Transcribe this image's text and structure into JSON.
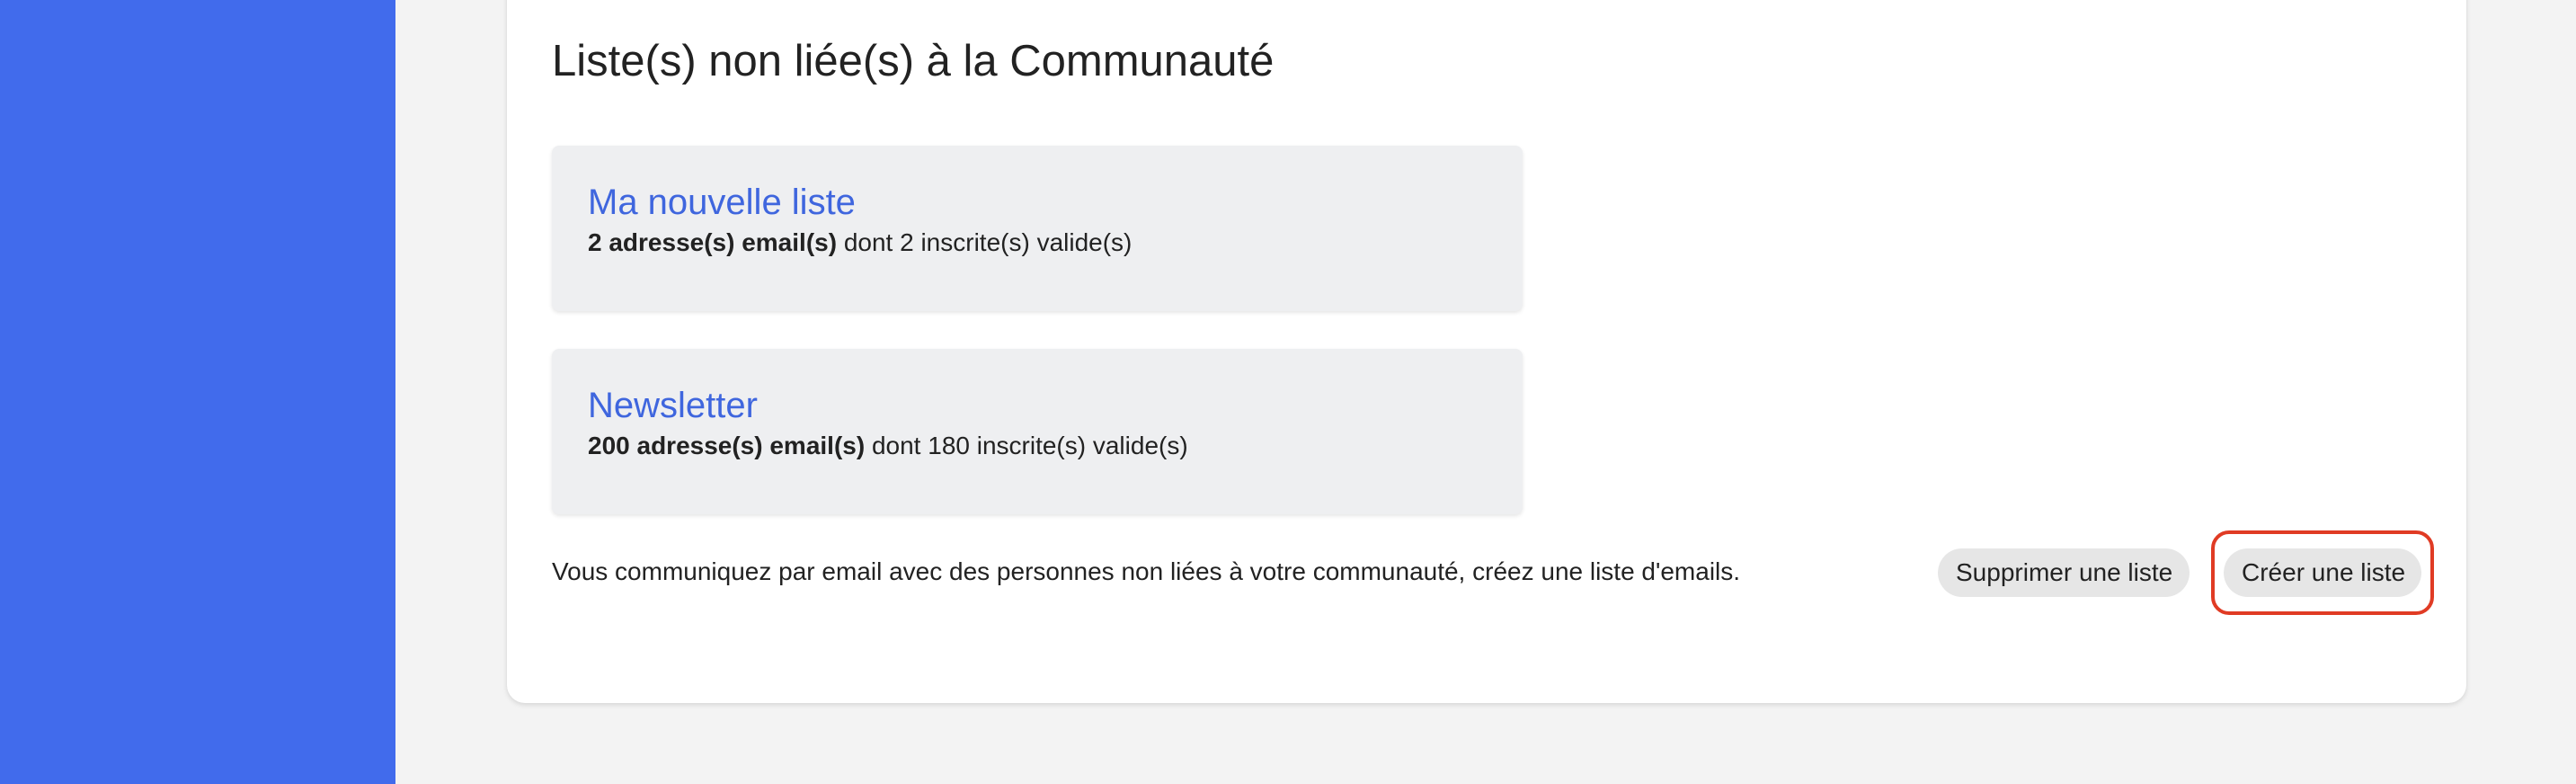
{
  "section": {
    "title": "Liste(s) non liée(s) à la Communauté"
  },
  "lists": [
    {
      "name": "Ma nouvelle liste",
      "count_text": "2 adresse(s) email(s)",
      "detail_text": " dont 2 inscrite(s) valide(s)"
    },
    {
      "name": "Newsletter",
      "count_text": "200 adresse(s) email(s)",
      "detail_text": " dont 180 inscrite(s) valide(s)"
    }
  ],
  "footer": {
    "info": "Vous communiquez par email avec des personnes non liées à votre communauté, créez une liste d'emails.",
    "delete_label": "Supprimer une liste",
    "create_label": "Créer une liste"
  },
  "colors": {
    "sidebar": "#416bec",
    "link": "#3f66de",
    "card_background": "#eeeff1",
    "button_background": "#e6e6e6",
    "highlight": "#e03b24"
  }
}
